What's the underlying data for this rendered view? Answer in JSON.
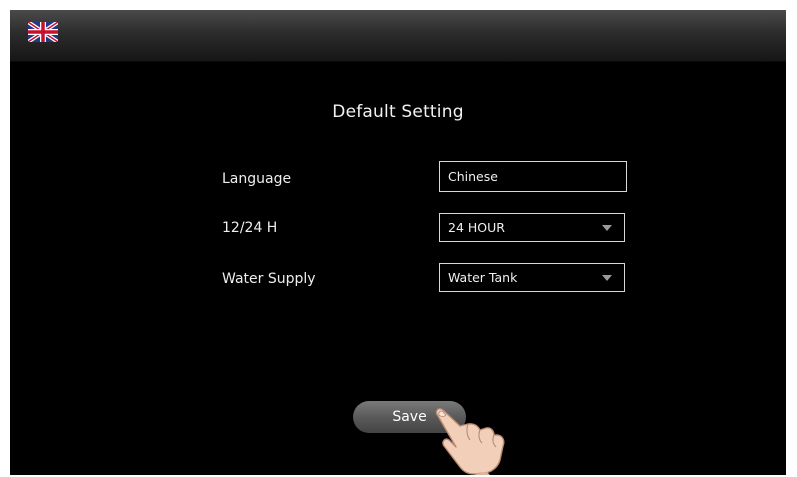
{
  "header": {
    "language_flag_icon": "uk-flag-icon"
  },
  "page": {
    "title": "Default Setting"
  },
  "settings": {
    "language": {
      "label": "Language",
      "value": "Chinese"
    },
    "hour_format": {
      "label": "12/24 H",
      "value": "24 HOUR"
    },
    "water_supply": {
      "label": "Water Supply",
      "value": "Water Tank"
    }
  },
  "actions": {
    "save_label": "Save"
  },
  "icons": {
    "dropdown": "chevron-down-icon",
    "pointer": "hand-pointer-icon"
  },
  "colors": {
    "background": "#000000",
    "text": "#f0f0f0",
    "field_border": "#d8d8d8",
    "button": "#5a5a5a"
  }
}
